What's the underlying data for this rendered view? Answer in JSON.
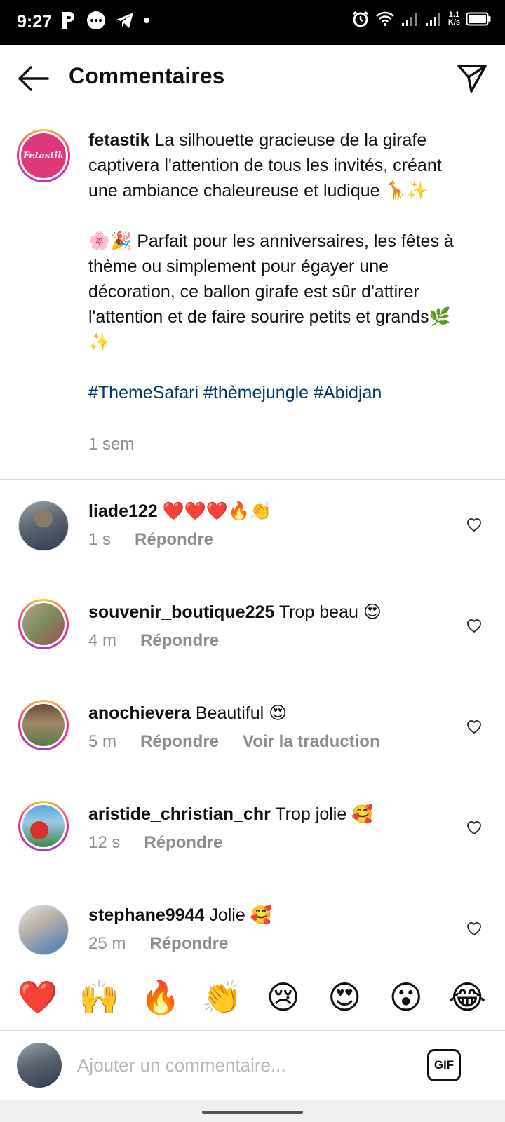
{
  "status_bar": {
    "time": "9:27",
    "speed": "1.1",
    "speed_unit": "K/s"
  },
  "header": {
    "title": "Commentaires"
  },
  "caption": {
    "username": "fetastik",
    "logo_text": "Fetastik",
    "paragraph1": "La silhouette gracieuse de la girafe captivera l'attention de tous les invités, créant une ambiance chaleureuse et ludique 🦒✨",
    "paragraph2": "🌸🎉 Parfait pour les anniversaires, les fêtes à thème ou simplement pour égayer une décoration, ce ballon girafe est sûr d'attirer l'attention et de faire sourire petits et grands🌿✨",
    "hashtags": "#ThemeSafari #thèmejungle #Abidjan",
    "time": "1 sem"
  },
  "comments": [
    {
      "username": "liade122",
      "text": "❤️❤️❤️🔥👏",
      "time": "1 s",
      "reply": "Répondre"
    },
    {
      "username": "souvenir_boutique225",
      "text": "Trop beau 😍",
      "time": "4 m",
      "reply": "Répondre"
    },
    {
      "username": "anochievera",
      "text": "Beautiful 😍",
      "time": "5 m",
      "reply": "Répondre",
      "translate": "Voir la traduction"
    },
    {
      "username": "aristide_christian_chr",
      "text": "Trop jolie 🥰",
      "time": "12 s",
      "reply": "Répondre"
    },
    {
      "username": "stephane9944",
      "text": "Jolie 🥰",
      "time": "25 m",
      "reply": "Répondre"
    }
  ],
  "emoji_bar": [
    "❤️",
    "🙌",
    "🔥",
    "👏",
    "😢",
    "😍",
    "😮",
    "😂"
  ],
  "input": {
    "placeholder": "Ajouter un commentaire...",
    "gif_label": "GIF"
  },
  "colors": {
    "hashtag": "#00376b",
    "muted": "#8e8e8e",
    "like_heart": "#e0245e"
  }
}
